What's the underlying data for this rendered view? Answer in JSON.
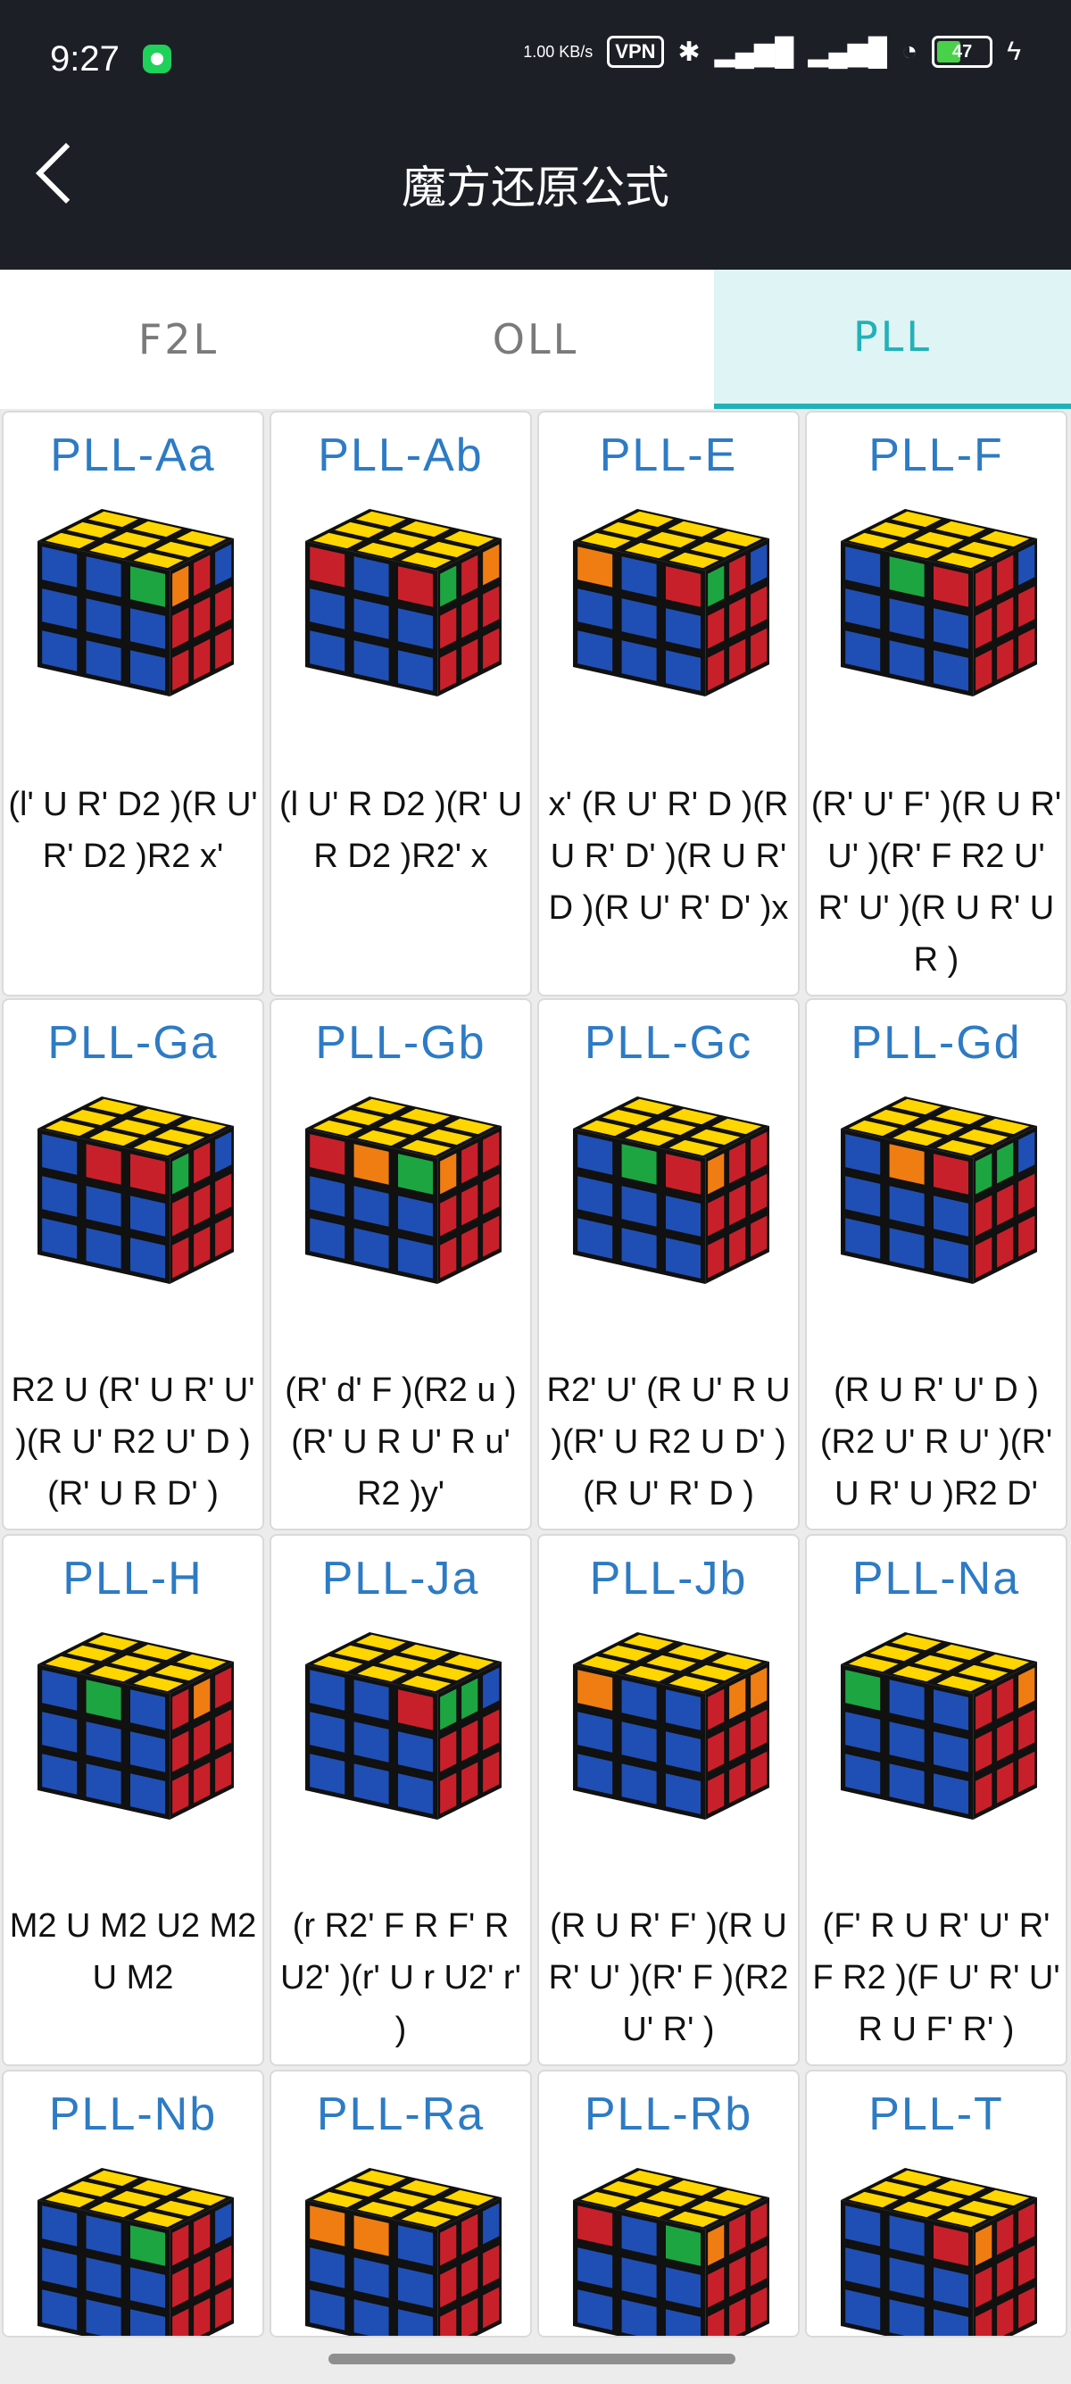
{
  "status_bar": {
    "time": "9:27",
    "net_speed": "1.00 KB/s",
    "vpn": "VPN",
    "battery": "47"
  },
  "header": {
    "title": "魔方还原公式"
  },
  "tabs": [
    {
      "label": "F2L",
      "active": false
    },
    {
      "label": "OLL",
      "active": false
    },
    {
      "label": "PLL",
      "active": true
    }
  ],
  "colors": {
    "yellow": "#ffd600",
    "blue": "#1f4fb5",
    "red": "#c8202a",
    "green": "#1da541",
    "orange": "#f07d12",
    "accent": "#21b2b8",
    "title_blue": "#2d7bc4"
  },
  "cards": [
    {
      "name": "PLL-Aa",
      "formula": "(l' U R' D2 )(R U' R' D2 )R2 x'",
      "top": [
        "Y",
        "Y",
        "Y",
        "Y",
        "Y",
        "Y",
        "Y",
        "Y",
        "Y"
      ],
      "front": [
        "B",
        "B",
        "G",
        "B",
        "B",
        "B",
        "B",
        "B",
        "B"
      ],
      "right": [
        "O",
        "R",
        "B",
        "R",
        "R",
        "R",
        "R",
        "R",
        "R"
      ]
    },
    {
      "name": "PLL-Ab",
      "formula": "(l U' R D2 )(R' U R D2 )R2' x",
      "top": [
        "Y",
        "Y",
        "Y",
        "Y",
        "Y",
        "Y",
        "Y",
        "Y",
        "Y"
      ],
      "front": [
        "R",
        "B",
        "R",
        "B",
        "B",
        "B",
        "B",
        "B",
        "B"
      ],
      "right": [
        "G",
        "R",
        "O",
        "R",
        "R",
        "R",
        "R",
        "R",
        "R"
      ]
    },
    {
      "name": "PLL-E",
      "formula": "x' (R U' R' D )(R U R' D' )(R U R' D )(R U' R' D' )x",
      "top": [
        "Y",
        "Y",
        "Y",
        "Y",
        "Y",
        "Y",
        "Y",
        "Y",
        "Y"
      ],
      "front": [
        "O",
        "B",
        "R",
        "B",
        "B",
        "B",
        "B",
        "B",
        "B"
      ],
      "right": [
        "G",
        "R",
        "B",
        "R",
        "R",
        "R",
        "R",
        "R",
        "R"
      ]
    },
    {
      "name": "PLL-F",
      "formula": "(R' U' F' )(R U R' U' )(R' F R2 U' R' U' )(R U R' U R )",
      "top": [
        "Y",
        "Y",
        "Y",
        "Y",
        "Y",
        "Y",
        "Y",
        "Y",
        "Y"
      ],
      "front": [
        "B",
        "G",
        "R",
        "B",
        "B",
        "B",
        "B",
        "B",
        "B"
      ],
      "right": [
        "R",
        "R",
        "B",
        "R",
        "R",
        "R",
        "R",
        "R",
        "R"
      ]
    },
    {
      "name": "PLL-Ga",
      "formula": "R2 U (R' U R' U' )(R U' R2 U' D )(R' U R D' )",
      "top": [
        "Y",
        "Y",
        "Y",
        "Y",
        "Y",
        "Y",
        "Y",
        "Y",
        "Y"
      ],
      "front": [
        "B",
        "R",
        "R",
        "B",
        "B",
        "B",
        "B",
        "B",
        "B"
      ],
      "right": [
        "G",
        "R",
        "B",
        "R",
        "R",
        "R",
        "R",
        "R",
        "R"
      ]
    },
    {
      "name": "PLL-Gb",
      "formula": "(R' d' F )(R2 u )(R' U R U' R u' R2 )y'",
      "top": [
        "Y",
        "Y",
        "Y",
        "Y",
        "Y",
        "Y",
        "Y",
        "Y",
        "Y"
      ],
      "front": [
        "R",
        "O",
        "G",
        "B",
        "B",
        "B",
        "B",
        "B",
        "B"
      ],
      "right": [
        "O",
        "R",
        "R",
        "R",
        "R",
        "R",
        "R",
        "R",
        "R"
      ]
    },
    {
      "name": "PLL-Gc",
      "formula": "R2' U' (R U' R U )(R' U R2 U D' )(R U' R' D )",
      "top": [
        "Y",
        "Y",
        "Y",
        "Y",
        "Y",
        "Y",
        "Y",
        "Y",
        "Y"
      ],
      "front": [
        "B",
        "G",
        "R",
        "B",
        "B",
        "B",
        "B",
        "B",
        "B"
      ],
      "right": [
        "O",
        "R",
        "R",
        "R",
        "R",
        "R",
        "R",
        "R",
        "R"
      ]
    },
    {
      "name": "PLL-Gd",
      "formula": "(R U R' U' D )(R2 U' R U' )(R' U R' U )R2 D'",
      "top": [
        "Y",
        "Y",
        "Y",
        "Y",
        "Y",
        "Y",
        "Y",
        "Y",
        "Y"
      ],
      "front": [
        "B",
        "O",
        "R",
        "B",
        "B",
        "B",
        "B",
        "B",
        "B"
      ],
      "right": [
        "G",
        "G",
        "B",
        "R",
        "R",
        "R",
        "R",
        "R",
        "R"
      ]
    },
    {
      "name": "PLL-H",
      "formula": "M2 U M2 U2 M2 U M2",
      "top": [
        "Y",
        "Y",
        "Y",
        "Y",
        "Y",
        "Y",
        "Y",
        "Y",
        "Y"
      ],
      "front": [
        "B",
        "G",
        "B",
        "B",
        "B",
        "B",
        "B",
        "B",
        "B"
      ],
      "right": [
        "R",
        "O",
        "R",
        "R",
        "R",
        "R",
        "R",
        "R",
        "R"
      ]
    },
    {
      "name": "PLL-Ja",
      "formula": "(r R2' F R F' R U2' )(r' U r U2' r' )",
      "top": [
        "Y",
        "Y",
        "Y",
        "Y",
        "Y",
        "Y",
        "Y",
        "Y",
        "Y"
      ],
      "front": [
        "B",
        "B",
        "R",
        "B",
        "B",
        "B",
        "B",
        "B",
        "B"
      ],
      "right": [
        "G",
        "G",
        "B",
        "R",
        "R",
        "R",
        "R",
        "R",
        "R"
      ]
    },
    {
      "name": "PLL-Jb",
      "formula": "(R U R' F' )(R U R' U' )(R' F )(R2 U' R' )",
      "top": [
        "Y",
        "Y",
        "Y",
        "Y",
        "Y",
        "Y",
        "Y",
        "Y",
        "Y"
      ],
      "front": [
        "O",
        "B",
        "B",
        "B",
        "B",
        "B",
        "B",
        "B",
        "B"
      ],
      "right": [
        "R",
        "O",
        "O",
        "R",
        "R",
        "R",
        "R",
        "R",
        "R"
      ]
    },
    {
      "name": "PLL-Na",
      "formula": "(F' R U R' U' R' F R2 )(F U' R' U' R U F' R' )",
      "top": [
        "Y",
        "Y",
        "Y",
        "Y",
        "Y",
        "Y",
        "Y",
        "Y",
        "Y"
      ],
      "front": [
        "G",
        "B",
        "B",
        "B",
        "B",
        "B",
        "B",
        "B",
        "B"
      ],
      "right": [
        "R",
        "R",
        "O",
        "R",
        "R",
        "R",
        "R",
        "R",
        "R"
      ]
    },
    {
      "name": "PLL-Nb",
      "formula": "",
      "top": [
        "Y",
        "Y",
        "Y",
        "Y",
        "Y",
        "Y",
        "Y",
        "Y",
        "Y"
      ],
      "front": [
        "B",
        "B",
        "G",
        "B",
        "B",
        "B",
        "B",
        "B",
        "B"
      ],
      "right": [
        "R",
        "R",
        "B",
        "R",
        "R",
        "R",
        "R",
        "R",
        "R"
      ]
    },
    {
      "name": "PLL-Ra",
      "formula": "",
      "top": [
        "Y",
        "Y",
        "Y",
        "Y",
        "Y",
        "Y",
        "Y",
        "Y",
        "Y"
      ],
      "front": [
        "O",
        "O",
        "B",
        "B",
        "B",
        "B",
        "B",
        "B",
        "B"
      ],
      "right": [
        "R",
        "R",
        "B",
        "R",
        "R",
        "R",
        "R",
        "R",
        "R"
      ]
    },
    {
      "name": "PLL-Rb",
      "formula": "",
      "top": [
        "Y",
        "Y",
        "Y",
        "Y",
        "Y",
        "Y",
        "Y",
        "Y",
        "Y"
      ],
      "front": [
        "R",
        "B",
        "G",
        "B",
        "B",
        "B",
        "B",
        "B",
        "B"
      ],
      "right": [
        "O",
        "R",
        "R",
        "R",
        "R",
        "R",
        "R",
        "R",
        "R"
      ]
    },
    {
      "name": "PLL-T",
      "formula": "",
      "top": [
        "Y",
        "Y",
        "Y",
        "Y",
        "Y",
        "Y",
        "Y",
        "Y",
        "Y"
      ],
      "front": [
        "B",
        "B",
        "R",
        "B",
        "B",
        "B",
        "B",
        "B",
        "B"
      ],
      "right": [
        "O",
        "R",
        "R",
        "R",
        "R",
        "R",
        "R",
        "R",
        "R"
      ]
    }
  ]
}
